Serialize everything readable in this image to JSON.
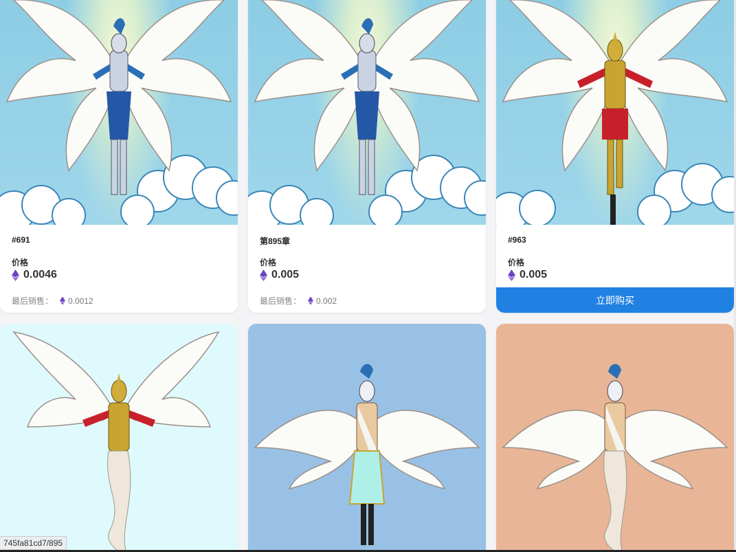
{
  "cards": [
    {
      "title": "#691",
      "price_label": "价格",
      "price": "0.0046",
      "last_sale_label": "最后销售：",
      "last_sale": "0.0012",
      "bg": "sky",
      "figure": "blue"
    },
    {
      "title": "第895章",
      "price_label": "价格",
      "price": "0.005",
      "last_sale_label": "最后销售：",
      "last_sale": "0.002",
      "bg": "sky",
      "figure": "blue"
    },
    {
      "title": "#963",
      "price_label": "价格",
      "price": "0.005",
      "buy_label": "立即购买",
      "bg": "sky",
      "figure": "gold"
    }
  ],
  "row2": [
    {
      "bg": "#dffafd",
      "figure": "gold"
    },
    {
      "bg": "#99c1e5",
      "figure": "toga-cyan"
    },
    {
      "bg": "#e8b597",
      "figure": "toga-white"
    }
  ],
  "status_url": "745fa81cd7/895",
  "colors": {
    "accent": "#2081e2",
    "eth": "#6b46c1"
  }
}
